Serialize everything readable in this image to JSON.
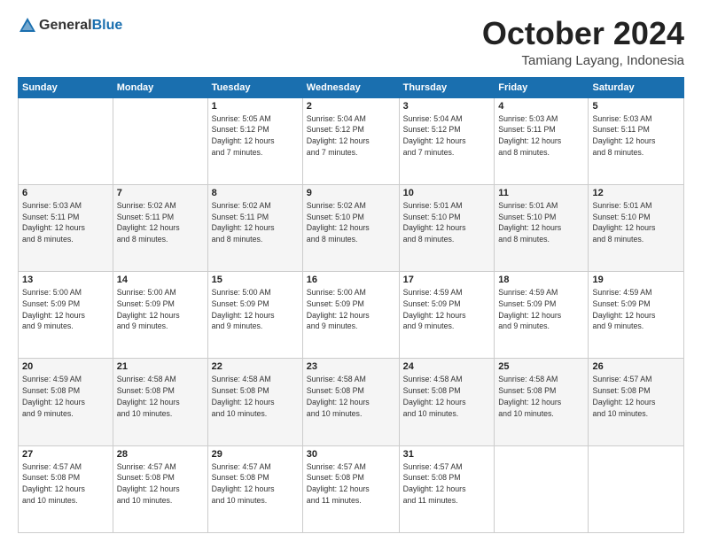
{
  "logo": {
    "general": "General",
    "blue": "Blue"
  },
  "header": {
    "month": "October 2024",
    "location": "Tamiang Layang, Indonesia"
  },
  "days_of_week": [
    "Sunday",
    "Monday",
    "Tuesday",
    "Wednesday",
    "Thursday",
    "Friday",
    "Saturday"
  ],
  "weeks": [
    [
      {
        "day": "",
        "info": ""
      },
      {
        "day": "",
        "info": ""
      },
      {
        "day": "1",
        "info": "Sunrise: 5:05 AM\nSunset: 5:12 PM\nDaylight: 12 hours\nand 7 minutes."
      },
      {
        "day": "2",
        "info": "Sunrise: 5:04 AM\nSunset: 5:12 PM\nDaylight: 12 hours\nand 7 minutes."
      },
      {
        "day": "3",
        "info": "Sunrise: 5:04 AM\nSunset: 5:12 PM\nDaylight: 12 hours\nand 7 minutes."
      },
      {
        "day": "4",
        "info": "Sunrise: 5:03 AM\nSunset: 5:11 PM\nDaylight: 12 hours\nand 8 minutes."
      },
      {
        "day": "5",
        "info": "Sunrise: 5:03 AM\nSunset: 5:11 PM\nDaylight: 12 hours\nand 8 minutes."
      }
    ],
    [
      {
        "day": "6",
        "info": "Sunrise: 5:03 AM\nSunset: 5:11 PM\nDaylight: 12 hours\nand 8 minutes."
      },
      {
        "day": "7",
        "info": "Sunrise: 5:02 AM\nSunset: 5:11 PM\nDaylight: 12 hours\nand 8 minutes."
      },
      {
        "day": "8",
        "info": "Sunrise: 5:02 AM\nSunset: 5:11 PM\nDaylight: 12 hours\nand 8 minutes."
      },
      {
        "day": "9",
        "info": "Sunrise: 5:02 AM\nSunset: 5:10 PM\nDaylight: 12 hours\nand 8 minutes."
      },
      {
        "day": "10",
        "info": "Sunrise: 5:01 AM\nSunset: 5:10 PM\nDaylight: 12 hours\nand 8 minutes."
      },
      {
        "day": "11",
        "info": "Sunrise: 5:01 AM\nSunset: 5:10 PM\nDaylight: 12 hours\nand 8 minutes."
      },
      {
        "day": "12",
        "info": "Sunrise: 5:01 AM\nSunset: 5:10 PM\nDaylight: 12 hours\nand 8 minutes."
      }
    ],
    [
      {
        "day": "13",
        "info": "Sunrise: 5:00 AM\nSunset: 5:09 PM\nDaylight: 12 hours\nand 9 minutes."
      },
      {
        "day": "14",
        "info": "Sunrise: 5:00 AM\nSunset: 5:09 PM\nDaylight: 12 hours\nand 9 minutes."
      },
      {
        "day": "15",
        "info": "Sunrise: 5:00 AM\nSunset: 5:09 PM\nDaylight: 12 hours\nand 9 minutes."
      },
      {
        "day": "16",
        "info": "Sunrise: 5:00 AM\nSunset: 5:09 PM\nDaylight: 12 hours\nand 9 minutes."
      },
      {
        "day": "17",
        "info": "Sunrise: 4:59 AM\nSunset: 5:09 PM\nDaylight: 12 hours\nand 9 minutes."
      },
      {
        "day": "18",
        "info": "Sunrise: 4:59 AM\nSunset: 5:09 PM\nDaylight: 12 hours\nand 9 minutes."
      },
      {
        "day": "19",
        "info": "Sunrise: 4:59 AM\nSunset: 5:09 PM\nDaylight: 12 hours\nand 9 minutes."
      }
    ],
    [
      {
        "day": "20",
        "info": "Sunrise: 4:59 AM\nSunset: 5:08 PM\nDaylight: 12 hours\nand 9 minutes."
      },
      {
        "day": "21",
        "info": "Sunrise: 4:58 AM\nSunset: 5:08 PM\nDaylight: 12 hours\nand 10 minutes."
      },
      {
        "day": "22",
        "info": "Sunrise: 4:58 AM\nSunset: 5:08 PM\nDaylight: 12 hours\nand 10 minutes."
      },
      {
        "day": "23",
        "info": "Sunrise: 4:58 AM\nSunset: 5:08 PM\nDaylight: 12 hours\nand 10 minutes."
      },
      {
        "day": "24",
        "info": "Sunrise: 4:58 AM\nSunset: 5:08 PM\nDaylight: 12 hours\nand 10 minutes."
      },
      {
        "day": "25",
        "info": "Sunrise: 4:58 AM\nSunset: 5:08 PM\nDaylight: 12 hours\nand 10 minutes."
      },
      {
        "day": "26",
        "info": "Sunrise: 4:57 AM\nSunset: 5:08 PM\nDaylight: 12 hours\nand 10 minutes."
      }
    ],
    [
      {
        "day": "27",
        "info": "Sunrise: 4:57 AM\nSunset: 5:08 PM\nDaylight: 12 hours\nand 10 minutes."
      },
      {
        "day": "28",
        "info": "Sunrise: 4:57 AM\nSunset: 5:08 PM\nDaylight: 12 hours\nand 10 minutes."
      },
      {
        "day": "29",
        "info": "Sunrise: 4:57 AM\nSunset: 5:08 PM\nDaylight: 12 hours\nand 10 minutes."
      },
      {
        "day": "30",
        "info": "Sunrise: 4:57 AM\nSunset: 5:08 PM\nDaylight: 12 hours\nand 11 minutes."
      },
      {
        "day": "31",
        "info": "Sunrise: 4:57 AM\nSunset: 5:08 PM\nDaylight: 12 hours\nand 11 minutes."
      },
      {
        "day": "",
        "info": ""
      },
      {
        "day": "",
        "info": ""
      }
    ]
  ]
}
